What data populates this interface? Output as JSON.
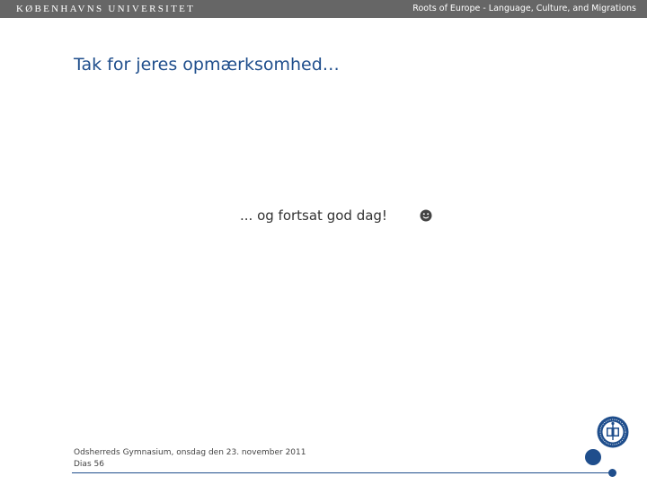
{
  "header": {
    "university": "KØBENHAVNS UNIVERSITET",
    "course": "Roots of Europe - Language, Culture, and Migrations"
  },
  "slide": {
    "title": "Tak for jeres opmærksomhed…",
    "body": "... og fortsat god dag!",
    "emoji_icon": "smiley-face-icon"
  },
  "footer": {
    "line1": "Odsherreds Gymnasium, onsdag den 23. november 2011",
    "line2": "Dias 56"
  },
  "colors": {
    "topbar": "#666666",
    "accent": "#1f4e8c",
    "text": "#333333"
  }
}
